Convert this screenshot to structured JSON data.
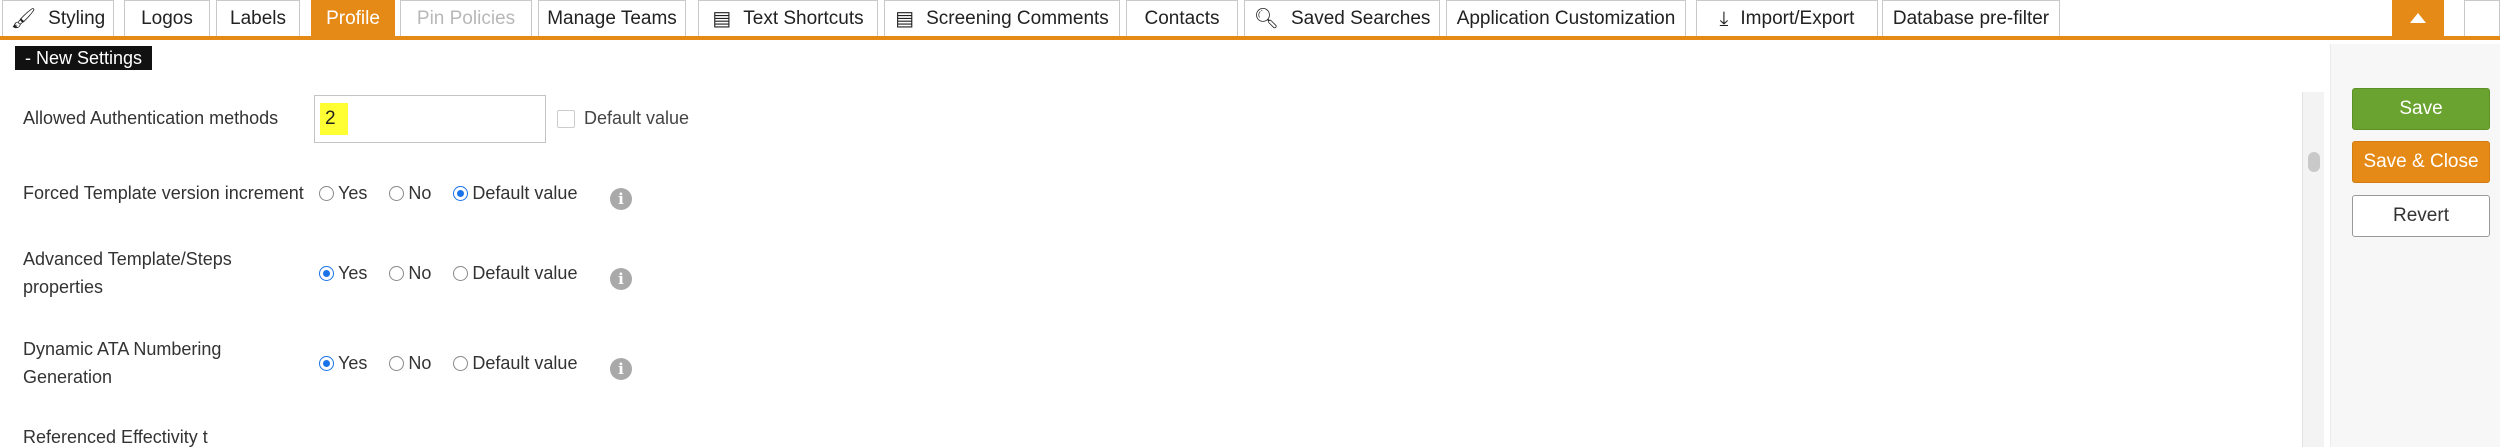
{
  "tabs": [
    {
      "label": "Styling",
      "icon": "paintbrush-icon",
      "state": "normal"
    },
    {
      "label": "Logos",
      "icon": "",
      "state": "normal"
    },
    {
      "label": "Labels",
      "icon": "",
      "state": "normal"
    },
    {
      "label": "Profile",
      "icon": "",
      "state": "active"
    },
    {
      "label": "Pin Policies",
      "icon": "",
      "state": "disabled"
    },
    {
      "label": "Manage Teams",
      "icon": "",
      "state": "normal"
    },
    {
      "label": "Text Shortcuts",
      "icon": "list-icon",
      "state": "normal"
    },
    {
      "label": "Screening Comments",
      "icon": "list-icon",
      "state": "normal"
    },
    {
      "label": "Contacts",
      "icon": "",
      "state": "normal"
    },
    {
      "label": "Saved Searches",
      "icon": "search-icon",
      "state": "normal"
    },
    {
      "label": "Application Customization",
      "icon": "",
      "state": "normal"
    },
    {
      "label": "Import/Export",
      "icon": "download-icon",
      "state": "normal"
    },
    {
      "label": "Database pre-filter",
      "icon": "",
      "state": "normal"
    }
  ],
  "section": {
    "label": "- New Settings"
  },
  "settings": {
    "auth": {
      "label": "Allowed Authentication methods",
      "value": "2",
      "default_label": "Default value",
      "default_checked": false
    },
    "forced_template": {
      "label": "Forced Template version increment",
      "options": [
        "Yes",
        "No",
        "Default value"
      ],
      "selected": "Default value"
    },
    "advanced_template": {
      "label_line1": "Advanced Template/Steps",
      "label_line2": "properties",
      "options": [
        "Yes",
        "No",
        "Default value"
      ],
      "selected": "Yes"
    },
    "dynamic_ata": {
      "label_line1": "Dynamic ATA Numbering",
      "label_line2": "Generation",
      "options": [
        "Yes",
        "No",
        "Default value"
      ],
      "selected": "Yes"
    },
    "partial_next": {
      "label": "Referenced Effectivity t"
    }
  },
  "actions": {
    "save": "Save",
    "save_close": "Save & Close",
    "revert": "Revert"
  },
  "colors": {
    "accent": "#e58a17",
    "save": "#6aa32f",
    "radio": "#1a73e8",
    "highlight": "#ffff33"
  }
}
